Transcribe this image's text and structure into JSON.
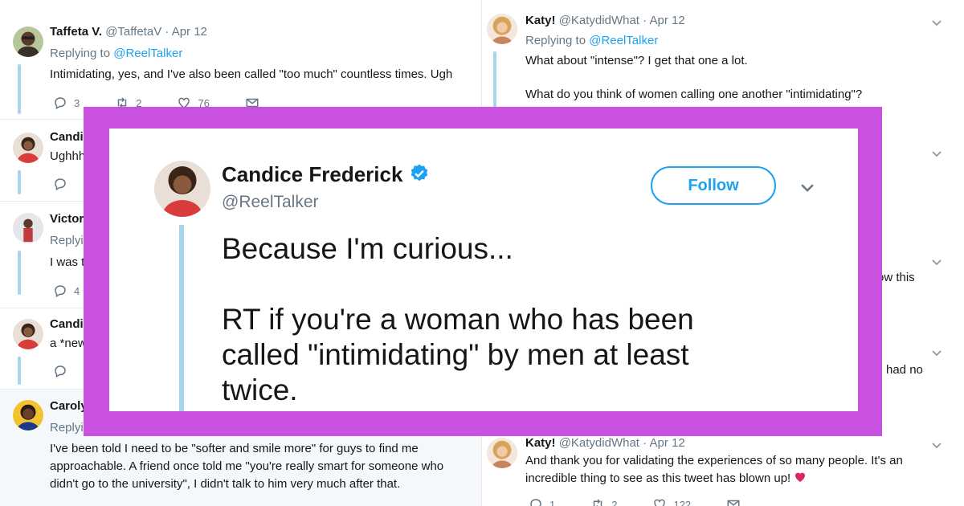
{
  "left_column": {
    "tweets": [
      {
        "name": "Taffeta V.",
        "handle": "@TaffetaV",
        "date": "· Apr 12",
        "replying_prefix": "Replying to",
        "replying_to": "@ReelTalker",
        "text": "Intimidating, yes, and I've also been called \"too much\" countless times. Ugh",
        "replies": "3",
        "retweets": "2",
        "likes": "76"
      },
      {
        "name": "Candi",
        "text": "Ughhh"
      },
      {
        "name": "Victor",
        "replying_prefix": "Replyi",
        "text": "I was t",
        "replies": "4"
      },
      {
        "name": "Candi",
        "text": "a *new"
      },
      {
        "name": "Caroly",
        "replying_prefix": "Replyi",
        "text_lines": [
          "I've been told I need to be \"softer and smile more\" for guys to find me",
          "approachable. A friend once told me \"you're really smart for someone who",
          "didn't go to the university\", I didn't talk to him very much after that."
        ]
      }
    ]
  },
  "right_column": {
    "tweets": [
      {
        "name": "Katy!",
        "handle": "@KatydidWhat",
        "date": "· Apr 12",
        "replying_prefix": "Replying to",
        "replying_to": "@ReelTalker",
        "text_lines": [
          "What about \"intense\"? I get that one a lot.",
          "What do you think of women calling one another \"intimidating\"?"
        ]
      },
      {
        "fragment": "ow this"
      },
      {
        "fragment": "had no"
      },
      {
        "name": "Katy!",
        "handle": "@KatydidWhat",
        "date": "· Apr 12",
        "text_lines": [
          "And thank you for validating the experiences of so many people. It's an",
          "incredible thing to see as this tweet has blown up!"
        ],
        "replies": "1",
        "retweets": "2",
        "likes": "122"
      }
    ]
  },
  "featured": {
    "name": "Candice Frederick",
    "handle": "@ReelTalker",
    "follow_label": "Follow",
    "line1": "Because I'm curious...",
    "line2": "RT if you're a woman who has been",
    "line3": "called \"intimidating\" by men at least",
    "line4": "twice."
  },
  "colors": {
    "frame": "#c951e0",
    "link": "#1da1f2",
    "thread_line": "#a8d4ec",
    "heart": "#e0245e"
  },
  "icons": [
    "reply-icon",
    "retweet-icon",
    "like-icon",
    "dm-icon",
    "chevron-down-icon",
    "verified-icon",
    "heart-emoji-icon"
  ]
}
